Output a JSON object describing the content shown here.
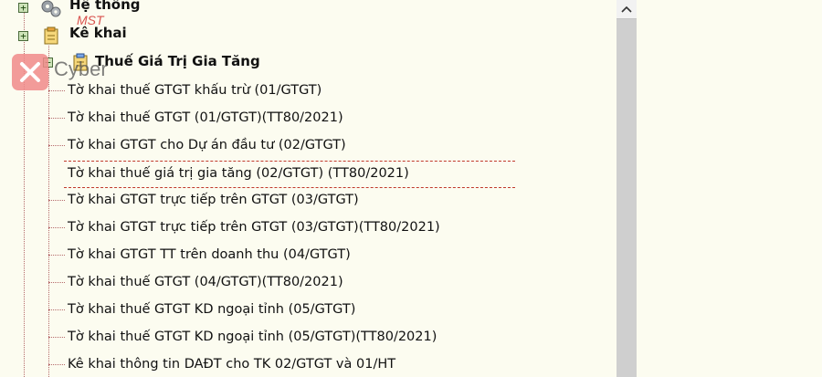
{
  "logo": {
    "text": "Cyber"
  },
  "overlay": {
    "mst": "MST"
  },
  "tree": {
    "nodes": [
      {
        "label": "Hệ thống",
        "expander": "+"
      },
      {
        "label": "Kê khai",
        "expander": "+"
      },
      {
        "label": "Thuế Giá Trị Gia Tăng",
        "expander": "−"
      }
    ],
    "items": [
      "Tờ khai thuế GTGT khấu trừ (01/GTGT)",
      "Tờ khai thuế GTGT (01/GTGT)(TT80/2021)",
      "Tờ khai GTGT cho Dự án đầu tư (02/GTGT)",
      "Tờ khai thuế giá trị gia tăng (02/GTGT) (TT80/2021)",
      "Tờ khai GTGT trực tiếp trên GTGT (03/GTGT)",
      "Tờ khai GTGT trực tiếp trên GTGT (03/GTGT)(TT80/2021)",
      "Tờ khai GTGT TT trên doanh thu (04/GTGT)",
      "Tờ khai thuế GTGT (04/GTGT)(TT80/2021)",
      "Tờ khai thuế GTGT KD ngoại tỉnh (05/GTGT)",
      "Tờ khai thuế GTGT KD ngoại tỉnh (05/GTGT)(TT80/2021)",
      "Kê khai thông tin DAĐT cho TK 02/GTGT và 01/HT"
    ],
    "selected_index": 3
  },
  "scrollbar": {
    "up_arrow": "^"
  }
}
